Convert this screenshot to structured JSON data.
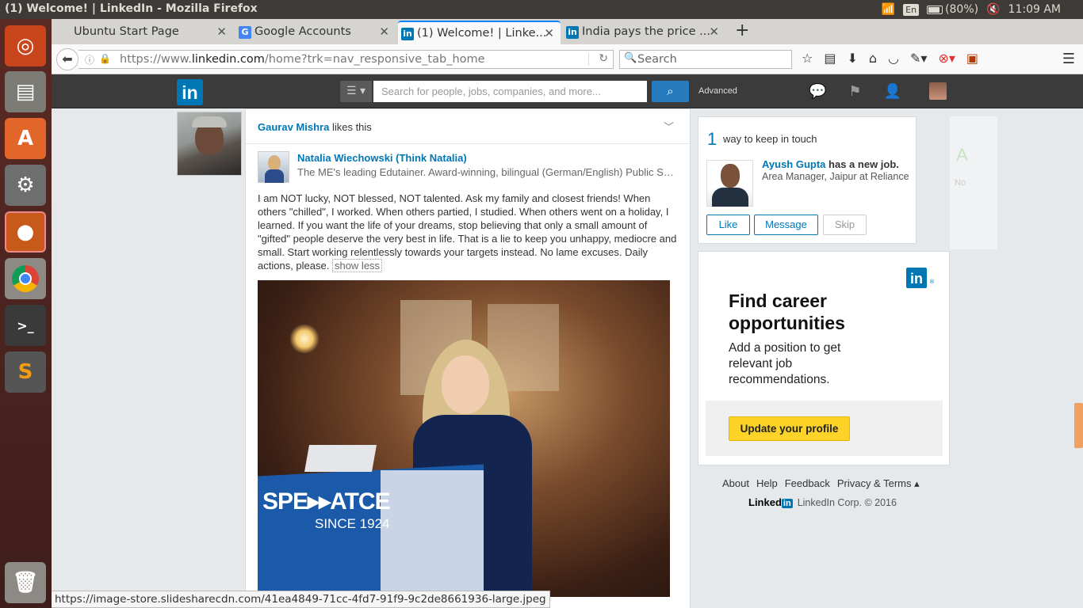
{
  "os": {
    "window_title": "(1) Welcome! | LinkedIn - Mozilla Firefox",
    "keyboard_lang": "En",
    "battery": "(80%)",
    "clock": "11:09 AM"
  },
  "launcher": {
    "items": [
      {
        "name": "ubuntu-dash-icon",
        "glyph": "◎",
        "color": "#dd4814"
      },
      {
        "name": "files-icon",
        "glyph": "🗄",
        "color": "#8c8a86"
      },
      {
        "name": "software-center-icon",
        "glyph": "A",
        "color": "#e95420"
      },
      {
        "name": "system-settings-icon",
        "glyph": "⚙",
        "color": "#7a7a7a"
      },
      {
        "name": "firefox-icon",
        "glyph": "🦊",
        "color": "#e66000"
      },
      {
        "name": "chrome-icon",
        "glyph": "◉",
        "color": "#ffffff"
      },
      {
        "name": "terminal-icon",
        "glyph": ">_",
        "color": "#2c2c2c"
      },
      {
        "name": "sublime-text-icon",
        "glyph": "S",
        "color": "#4a4a4a"
      },
      {
        "name": "trash-icon",
        "glyph": "🗑",
        "color": "#cfcfcf"
      }
    ]
  },
  "tabs": [
    {
      "label": "Ubuntu Start Page",
      "fav": "",
      "favcolor": "transparent"
    },
    {
      "label": "Google Accounts",
      "fav": "G",
      "favcolor": "#4285f4"
    },
    {
      "label": "(1) Welcome! | Linke...",
      "fav": "in",
      "favcolor": "#0077b5"
    },
    {
      "label": "India pays the price ...",
      "fav": "in",
      "favcolor": "#0077b5"
    }
  ],
  "nav": {
    "url_prefix": "https://www.",
    "url_domain": "linkedin.com",
    "url_path": "/home?trk=nav_responsive_tab_home",
    "search_placeholder": "Search"
  },
  "linkedin": {
    "logo": "in",
    "search_placeholder": "Search for people, jobs, companies, and more...",
    "advanced": "Advanced",
    "feed": {
      "actor": "Gaurav Mishra",
      "action": "likes this",
      "author_name": "Natalia Wiechowski (Think Natalia)",
      "author_headline": "The ME's leading Edutainer. Award-winning, bilingual (German/English) Public Speaker & Coach",
      "post_text": "I am NOT lucky, NOT blessed, NOT talented. Ask my family and closest friends! When others \"chilled\", I worked. When others partied, I studied. When others went on a holiday, I learned. If you want the life of your dreams, stop believing that only a small amount of \"gifted\" people deserve the very best in life. That is a lie to keep you unhappy, mediocre and small. Start working relentlessly towards your targets instead. No lame excuses. Daily actions, please.",
      "show_less": "show less",
      "image_sign_text": "SPE",
      "image_sign_text2": "ATCE",
      "image_since": "SINCE 1924"
    },
    "keep_in_touch": {
      "count": "1",
      "label": "way to keep in touch",
      "person": "Ayush Gupta",
      "news": "has a new job.",
      "detail": "Area Manager, Jaipur at Reliance",
      "like": "Like",
      "message": "Message",
      "skip": "Skip"
    },
    "ad": {
      "logo": "in",
      "reg": "®",
      "title": "Find career opportunities",
      "body": "Add a position to get relevant job recommendations.",
      "button": "Update your profile"
    },
    "ghost_letter": "A",
    "ghost_small": "No",
    "footer": {
      "links": [
        "About",
        "Help",
        "Feedback",
        "Privacy & Terms ▴"
      ],
      "brand": "Linked",
      "brand_in": "in",
      "copyright": "LinkedIn Corp. © 2016"
    }
  },
  "status_url": "https://image-store.slidesharecdn.com/41ea4849-71cc-4fd7-91f9-9c2de8661936-large.jpeg"
}
